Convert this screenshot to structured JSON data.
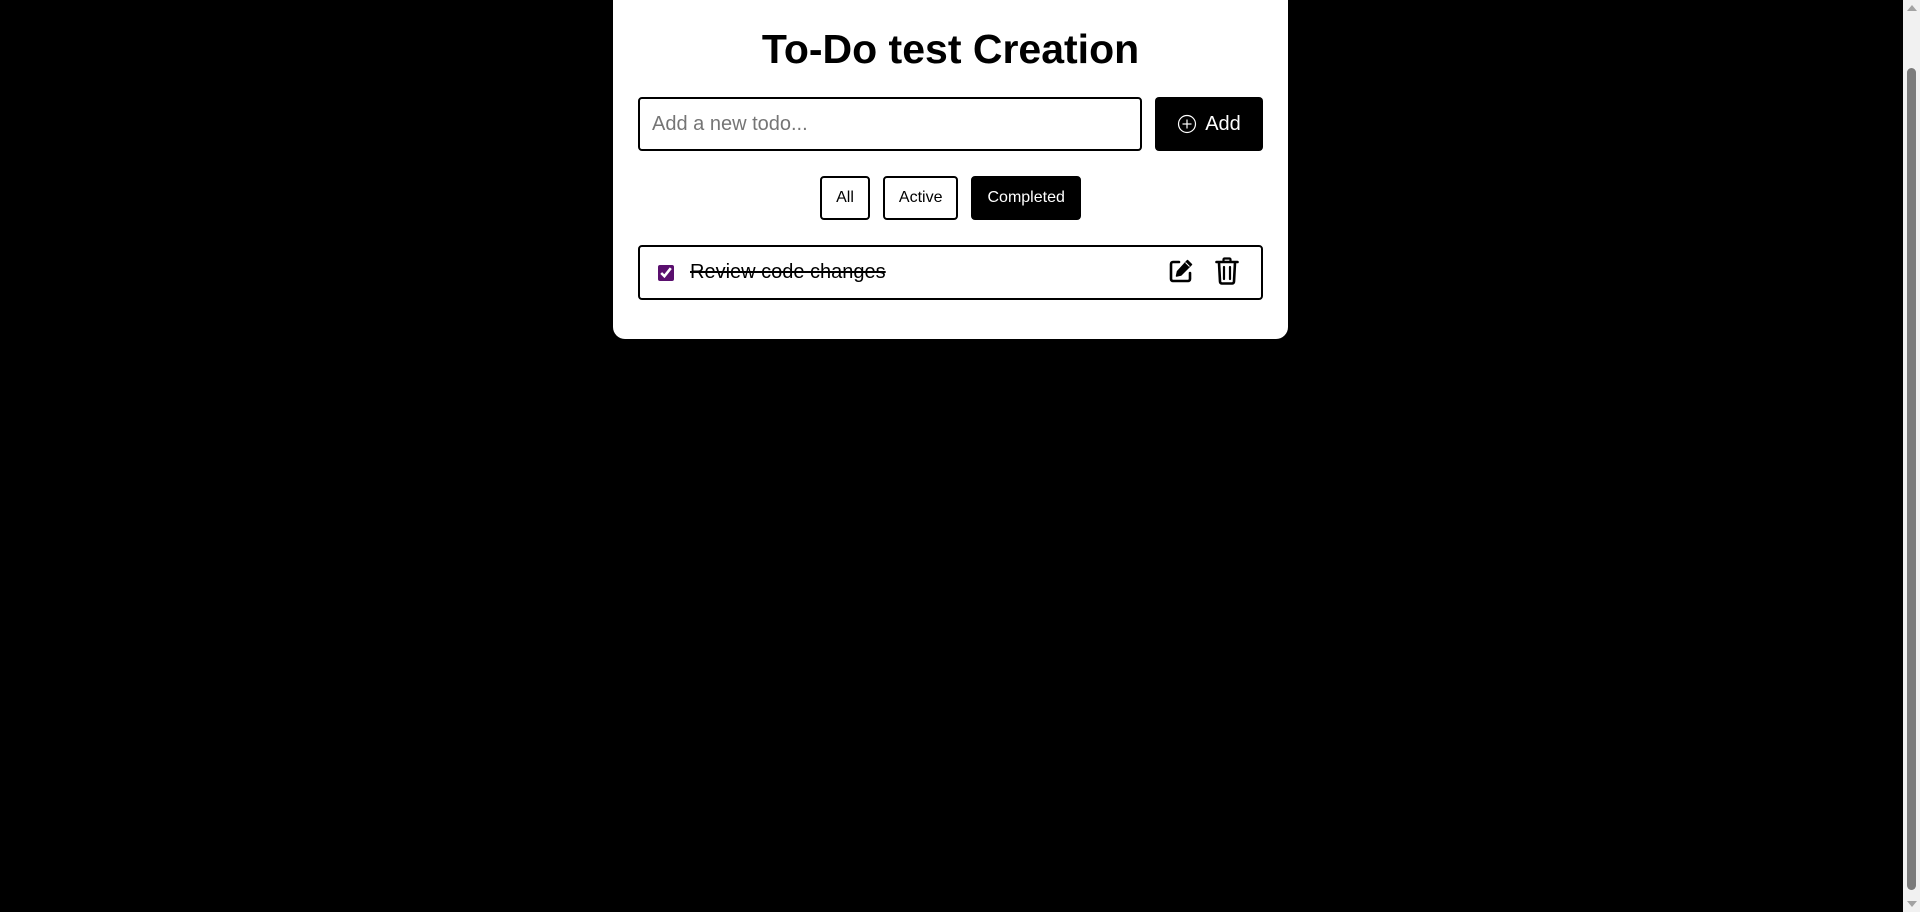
{
  "app": {
    "title": "To-Do test Creation"
  },
  "input": {
    "placeholder": "Add a new todo...",
    "value": ""
  },
  "add_button": {
    "label": "Add",
    "icon": "plus-circle-icon"
  },
  "filters": [
    {
      "label": "All",
      "selected": false
    },
    {
      "label": "Active",
      "selected": false
    },
    {
      "label": "Completed",
      "selected": true
    }
  ],
  "todos": [
    {
      "text": "Review code changes",
      "completed": true,
      "edit_icon": "edit-icon",
      "delete_icon": "trash-icon"
    }
  ],
  "colors": {
    "background": "#000000",
    "card": "#ffffff",
    "accent": "#000000",
    "checkbox": "#5a0f6e"
  }
}
